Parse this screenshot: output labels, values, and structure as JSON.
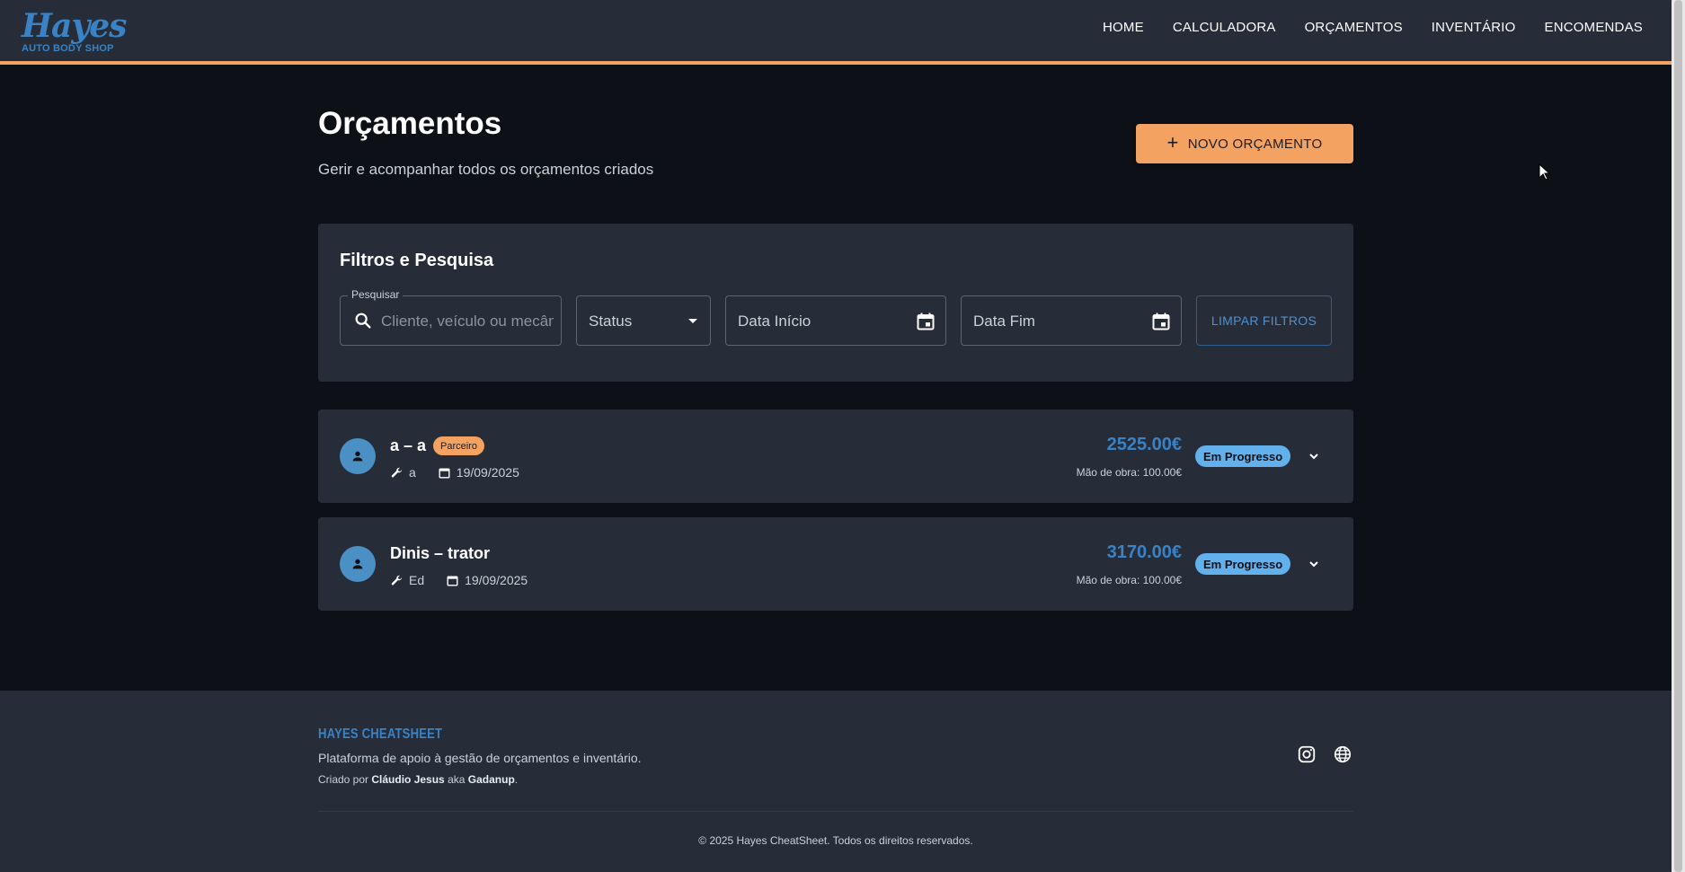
{
  "header": {
    "logo_script": "Hayes",
    "logo_sub": "AUTO BODY SHOP",
    "nav": [
      "HOME",
      "CALCULADORA",
      "ORÇAMENTOS",
      "INVENTÁRIO",
      "ENCOMENDAS"
    ]
  },
  "page": {
    "title": "Orçamentos",
    "subtitle": "Gerir e acompanhar todos os orçamentos criados",
    "new_button": "NOVO ORÇAMENTO"
  },
  "filters": {
    "title": "Filtros e Pesquisa",
    "search_label": "Pesquisar",
    "search_placeholder": "Cliente, veículo ou mecânico",
    "status_label": "Status",
    "date_start_label": "Data Início",
    "date_end_label": "Data Fim",
    "clear_button": "LIMPAR FILTROS"
  },
  "quotes": [
    {
      "title": "a – a",
      "badge": "Parceiro",
      "mechanic": "a",
      "date": "19/09/2025",
      "total": "2525.00€",
      "labor": "Mão de obra: 100.00€",
      "status": "Em Progresso"
    },
    {
      "title": "Dinis – trator",
      "badge": null,
      "mechanic": "Ed",
      "date": "19/09/2025",
      "total": "3170.00€",
      "labor": "Mão de obra: 100.00€",
      "status": "Em Progresso"
    }
  ],
  "footer": {
    "brand": "HAYES CHEATSHEET",
    "description": "Plataforma de apoio à gestão de orçamentos e inventário.",
    "credit_prefix": "Criado por",
    "credit_name": "Cláudio Jesus",
    "credit_aka": "aka",
    "credit_alias": "Gadanup",
    "copyright": "© 2025 Hayes CheatSheet. Todos os direitos reservados."
  },
  "colors": {
    "accent_orange": "#f4a261",
    "accent_blue": "#3a82c4",
    "status_blue": "#62b0ec",
    "panel": "#262d38",
    "background": "#0d1117"
  }
}
